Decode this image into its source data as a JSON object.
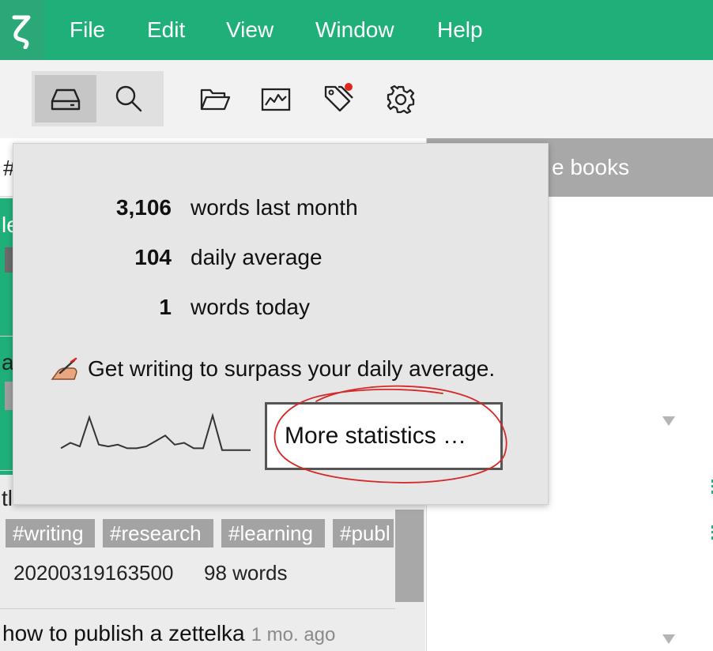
{
  "app": {
    "logo_glyph": "ζ"
  },
  "menu": [
    "File",
    "Edit",
    "View",
    "Window",
    "Help"
  ],
  "toolbar": {
    "icons": [
      "drive-icon",
      "search-icon",
      "folder-open-icon",
      "statistics-icon",
      "tags-icon",
      "settings-icon"
    ],
    "notification_color": "#e0271b"
  },
  "left_pane": {
    "partial_letters": [
      "#",
      "le",
      "a",
      "tl"
    ],
    "tags": [
      "#writing",
      "#research",
      "#learning",
      "#publ"
    ],
    "meta": {
      "id": "20200319163500",
      "words": "98 words"
    },
    "next_note": {
      "title": "how to publish a zettelka",
      "age": "1 mo. ago"
    }
  },
  "right_pane": {
    "header": "e books"
  },
  "popover": {
    "stats": [
      {
        "value": "3,106",
        "label": "words last month"
      },
      {
        "value": "104",
        "label": "daily average"
      },
      {
        "value": "1",
        "label": "words today"
      }
    ],
    "advice": "Get writing to surpass your daily average.",
    "more_button": "More statistics …",
    "sparkline": [
      0.1,
      0.25,
      0.15,
      0.95,
      0.2,
      0.15,
      0.2,
      0.1,
      0.1,
      0.15,
      0.3,
      0.45,
      0.2,
      0.25,
      0.1,
      0.1,
      1.0,
      0.05,
      0.05,
      0.05,
      0.05
    ]
  },
  "colors": {
    "accent": "#1fb07a",
    "annotation": "#d42a2a"
  }
}
